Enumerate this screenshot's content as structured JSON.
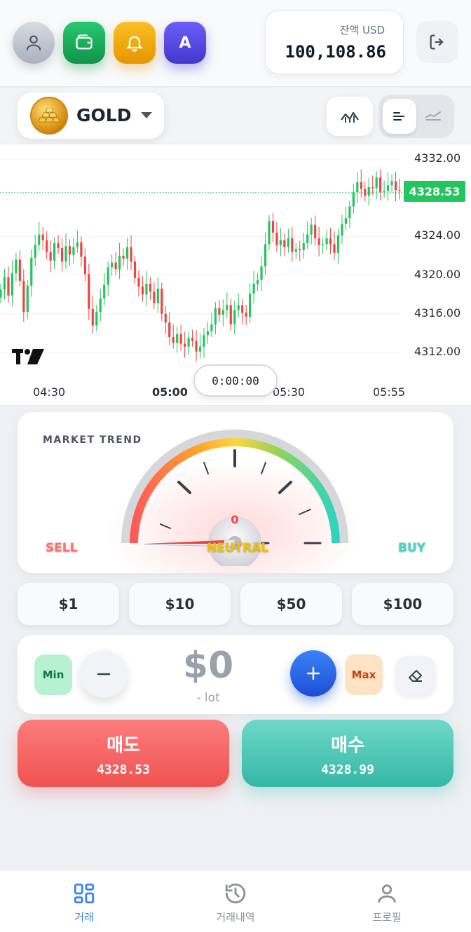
{
  "header": {
    "profile_icon": "user-icon",
    "wallet_icon": "wallet-icon",
    "bell_icon": "bell-icon",
    "avatar_letter": "A",
    "balance_label": "잔액 USD",
    "balance_value": "100,108.86",
    "logout_icon": "logout-icon"
  },
  "symbol": {
    "name": "GOLD",
    "icon": "gold-bars-icon"
  },
  "chart": {
    "current_price": "4328.53",
    "y_ticks": [
      "4332.00",
      "4324.00",
      "4320.00",
      "4316.00",
      "4312.00"
    ],
    "x_ticks": [
      "04:30",
      "05:00",
      "05:30",
      "05:55"
    ],
    "timer": "0:00:00",
    "logo": "TV"
  },
  "chart_data": {
    "type": "candlestick",
    "x_ticks": [
      "04:30",
      "05:00",
      "05:30",
      "05:55"
    ],
    "y_ticks": [
      4312.0,
      4316.0,
      4320.0,
      4324.0,
      4332.0
    ],
    "ylim": [
      4310.0,
      4333.6
    ],
    "last_price": 4328.53,
    "up_color": "#22c55e",
    "down_color": "#ef4444",
    "closes": [
      4318.5,
      4319.8,
      4317.9,
      4320.2,
      4321.6,
      4319.4,
      4316.2,
      4318.9,
      4321.8,
      4323.1,
      4324.2,
      4323.6,
      4322.4,
      4321.5,
      4323.3,
      4322.8,
      4321.4,
      4323.0,
      4322.1,
      4322.9,
      4323.4,
      4321.9,
      4320.1,
      4316.5,
      4314.8,
      4316.2,
      4317.6,
      4319.0,
      4320.8,
      4321.3,
      4320.6,
      4322.0,
      4321.7,
      4322.9,
      4321.4,
      4319.7,
      4318.8,
      4318.0,
      4319.1,
      4318.3,
      4317.1,
      4318.6,
      4316.0,
      4315.1,
      4313.6,
      4313.0,
      4313.9,
      4312.9,
      4312.6,
      4313.5,
      4313.2,
      4312.1,
      4312.6,
      4313.8,
      4314.2,
      4314.9,
      4316.6,
      4315.9,
      4316.4,
      4316.9,
      4314.9,
      4316.4,
      4316.9,
      4316.1,
      4315.7,
      4318.1,
      4319.1,
      4319.5,
      4320.9,
      4323.2,
      4325.6,
      4324.4,
      4323.1,
      4323.6,
      4322.9,
      4323.8,
      4322.4,
      4322.7,
      4322.6,
      4323.3,
      4324.2,
      4325.2,
      4323.8,
      4323.1,
      4323.2,
      4323.8,
      4323.2,
      4322.3,
      4324.1,
      4325.3,
      4325.9,
      4327.1,
      4328.6,
      4329.6,
      4328.9,
      4328.2,
      4329.1,
      4329.0,
      4330.1,
      4328.6,
      4328.7,
      4329.3,
      4329.7,
      4328.8,
      4328.7
    ]
  },
  "trend": {
    "title": "MARKET TREND",
    "value": "0",
    "sell_label": "SELL",
    "neutral_label": "NEUTRAL",
    "buy_label": "BUY"
  },
  "presets": [
    "$1",
    "$10",
    "$50",
    "$100"
  ],
  "lot": {
    "min_label": "Min",
    "max_label": "Max",
    "amount": "$0",
    "lot_text": "- lot"
  },
  "trade": {
    "sell_label": "매도",
    "sell_price": "4328.53",
    "buy_label": "매수",
    "buy_price": "4328.99"
  },
  "nav": {
    "items": [
      {
        "label": "거래",
        "icon": "grid-icon",
        "active": true
      },
      {
        "label": "거래내역",
        "icon": "history-icon",
        "active": false
      },
      {
        "label": "프로필",
        "icon": "profile-icon",
        "active": false
      }
    ],
    "active_color": "#3b82f6"
  }
}
